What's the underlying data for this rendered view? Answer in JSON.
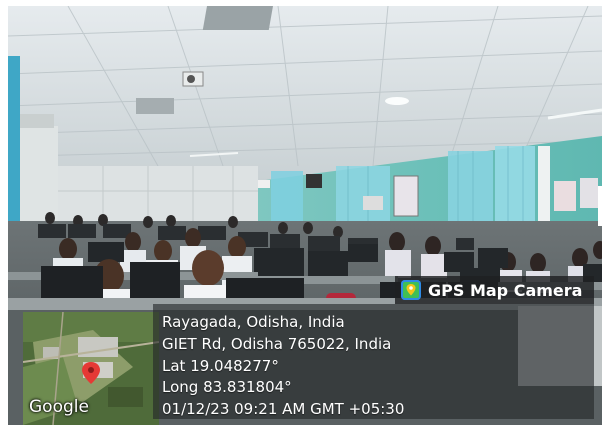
{
  "gps_camera": {
    "app_name": "GPS Map Camera",
    "city_line": "Rayagada, Odisha, India",
    "address_line": "GIET Rd, Odisha 765022, India",
    "lat_line": "Lat 19.048277°",
    "long_line": "Long 83.831804°",
    "datetime_line": "01/12/23 09:21 AM GMT +05:30",
    "map_attribution": "Google"
  }
}
